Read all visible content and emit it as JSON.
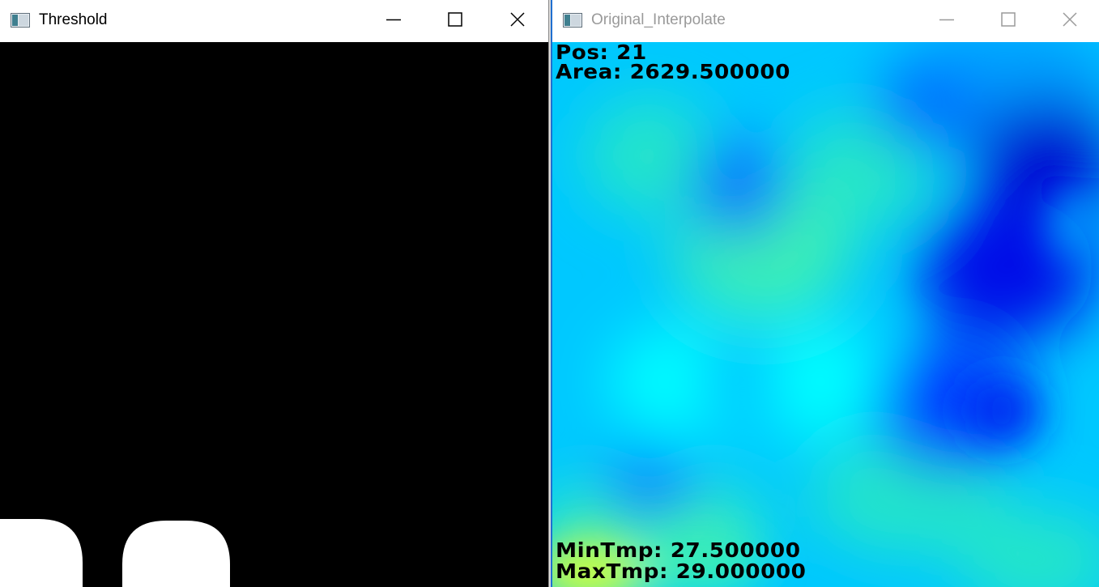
{
  "windows": {
    "threshold": {
      "title": "Threshold"
    },
    "interpolate": {
      "title": "Original_Interpolate",
      "overlay": {
        "pos": "Pos: 21",
        "area": "Area: 2629.500000",
        "min_tmp": "MinTmp: 27.500000",
        "max_tmp": "MaxTmp: 29.000000"
      }
    }
  },
  "icons": [
    "app-icon",
    "minimize-icon",
    "maximize-icon",
    "close-icon"
  ],
  "colors": {
    "threshold_background": "#000000",
    "threshold_blob": "#ffffff",
    "heatmap_deep_blue": "#0000e0",
    "heatmap_blue": "#0064ff",
    "heatmap_cyan": "#00ffff",
    "heatmap_green": "#3cf0b4",
    "heatmap_yellow": "#d2ff3c",
    "inactive_title": "#9a9a9a"
  }
}
